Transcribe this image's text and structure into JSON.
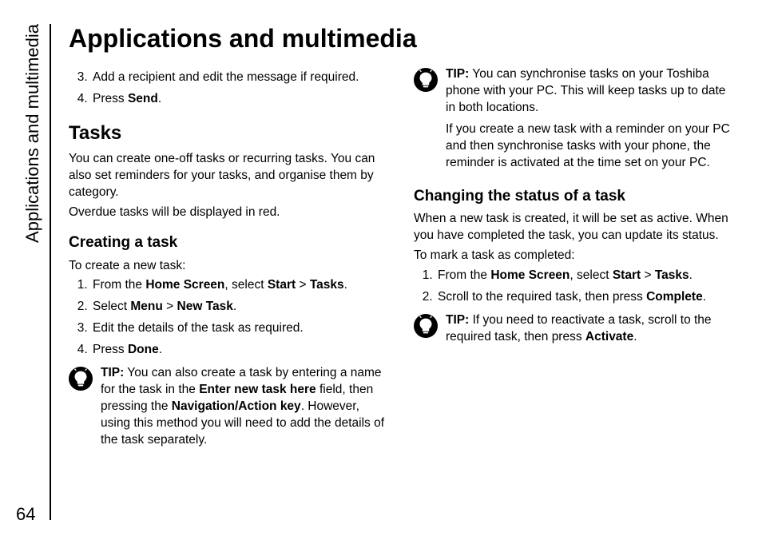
{
  "side_tab": "Applications and multimedia",
  "page_number": "64",
  "title": "Applications and multimedia",
  "col1": {
    "list_top": {
      "item3_a": "Add a recipient and edit the message if required.",
      "item4_a": "Press ",
      "item4_b": "Send",
      "item4_c": "."
    },
    "tasks_h": "Tasks",
    "tasks_p1": "You can create one-off tasks or recurring tasks. You can also set reminders for your tasks, and organise them by category.",
    "tasks_p2": "Overdue tasks will be displayed in red.",
    "creating_h": "Creating a task",
    "creating_intro": "To create a new task:",
    "creating_list": {
      "i1_a": "From the ",
      "i1_b": "Home Screen",
      "i1_c": ", select ",
      "i1_d": "Start",
      "i1_gt": " > ",
      "i1_e": "Tasks",
      "i1_f": ".",
      "i2_a": "Select ",
      "i2_b": "Menu",
      "i2_gt": " > ",
      "i2_c": "New Task",
      "i2_d": ".",
      "i3": "Edit the details of the task as required.",
      "i4_a": "Press ",
      "i4_b": "Done",
      "i4_c": "."
    },
    "tip1": {
      "label": "TIP:",
      "t1": " You can also create a task by entering a name for the task in the ",
      "t2": "Enter new task here",
      "t3": " field, then pressing the ",
      "t4": "Navigation/Action key",
      "t5": ". However, using this method you will need to add the details of the task separately."
    }
  },
  "col2": {
    "tip2": {
      "label": "TIP:",
      "p1": " You can synchronise tasks on your Toshiba phone with your PC. This will keep tasks up to date in both locations.",
      "p2": "If you create a new task with a reminder on your PC and then synchronise tasks with your phone, the reminder is activated at the time set on your PC."
    },
    "changing_h": "Changing the status of a task",
    "changing_p1": "When a new task is created, it will be set as active. When you have completed the task, you can update its status.",
    "changing_intro": "To mark a task as completed:",
    "changing_list": {
      "i1_a": "From the ",
      "i1_b": "Home Screen",
      "i1_c": ", select ",
      "i1_d": "Start",
      "i1_gt": " > ",
      "i1_e": "Tasks",
      "i1_f": ".",
      "i2_a": "Scroll to the required task, then press ",
      "i2_b": "Complete",
      "i2_c": "."
    },
    "tip3": {
      "label": "TIP:",
      "t1": " If you need to reactivate a task, scroll to the required task, then press ",
      "t2": "Activate",
      "t3": "."
    }
  }
}
